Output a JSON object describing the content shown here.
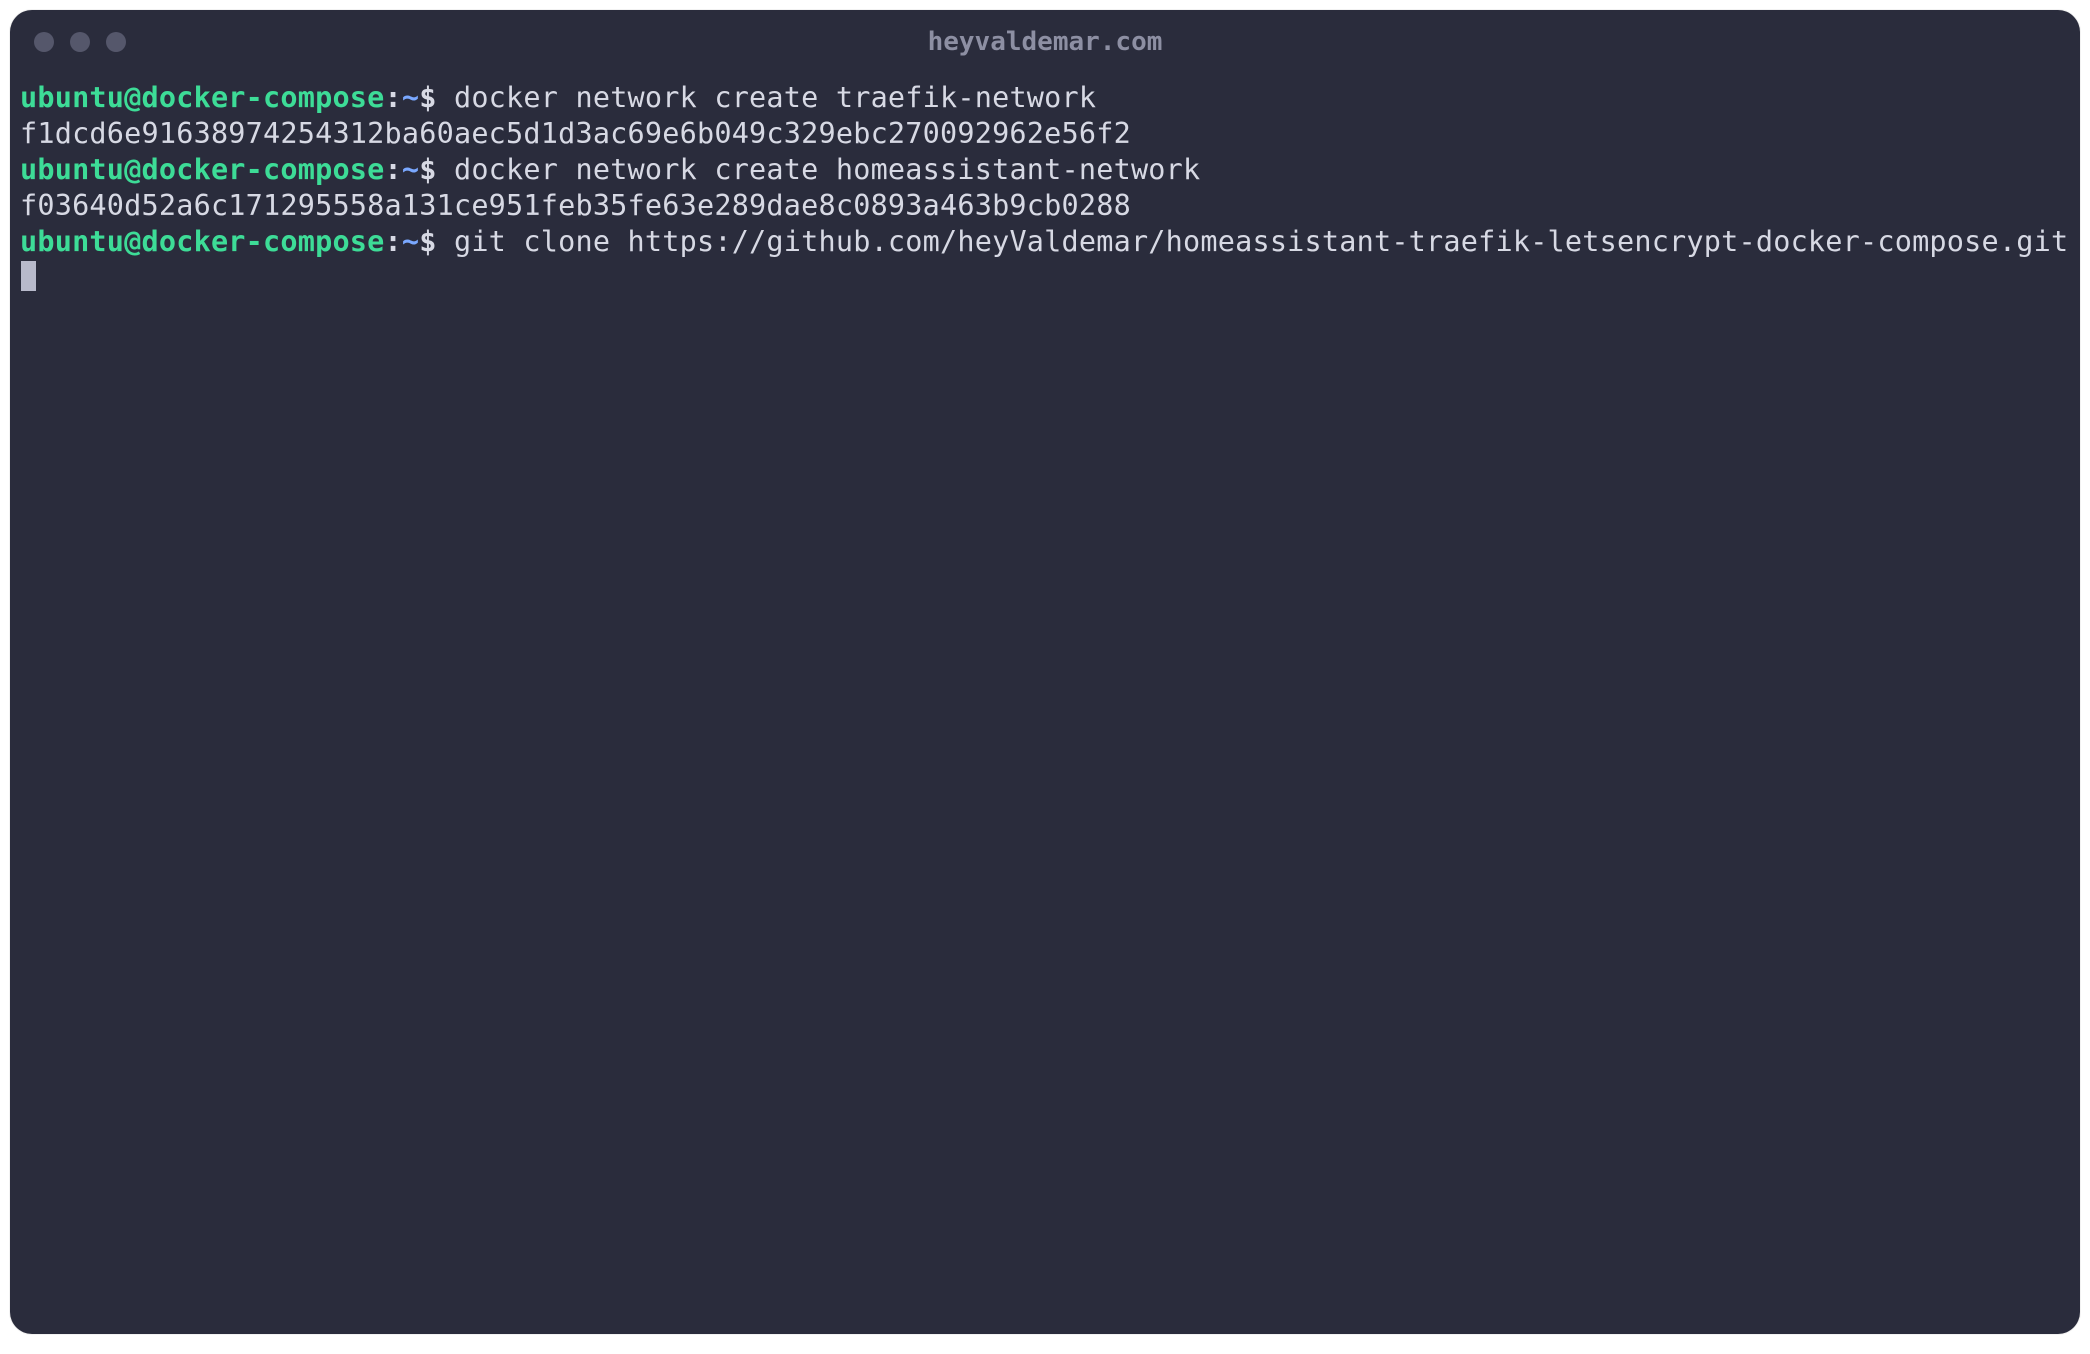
{
  "window": {
    "title": "heyvaldemar.com"
  },
  "prompt": {
    "user_host": "ubuntu@docker-compose",
    "sep": ":",
    "cwd": "~",
    "sigil": "$"
  },
  "lines": {
    "l0_cmd": " docker network create traefik-network",
    "l1_out": "f1dcd6e91638974254312ba60aec5d1d3ac69e6b049c329ebc270092962e56f2",
    "l2_cmd": " docker network create homeassistant-network",
    "l3_out": "f03640d52a6c171295558a131ce951feb35fe63e289dae8c0893a463b9cb0288",
    "l4_cmd": " git clone https://github.com/heyValdemar/homeassistant-traefik-letsencrypt-docker-compose.git"
  }
}
